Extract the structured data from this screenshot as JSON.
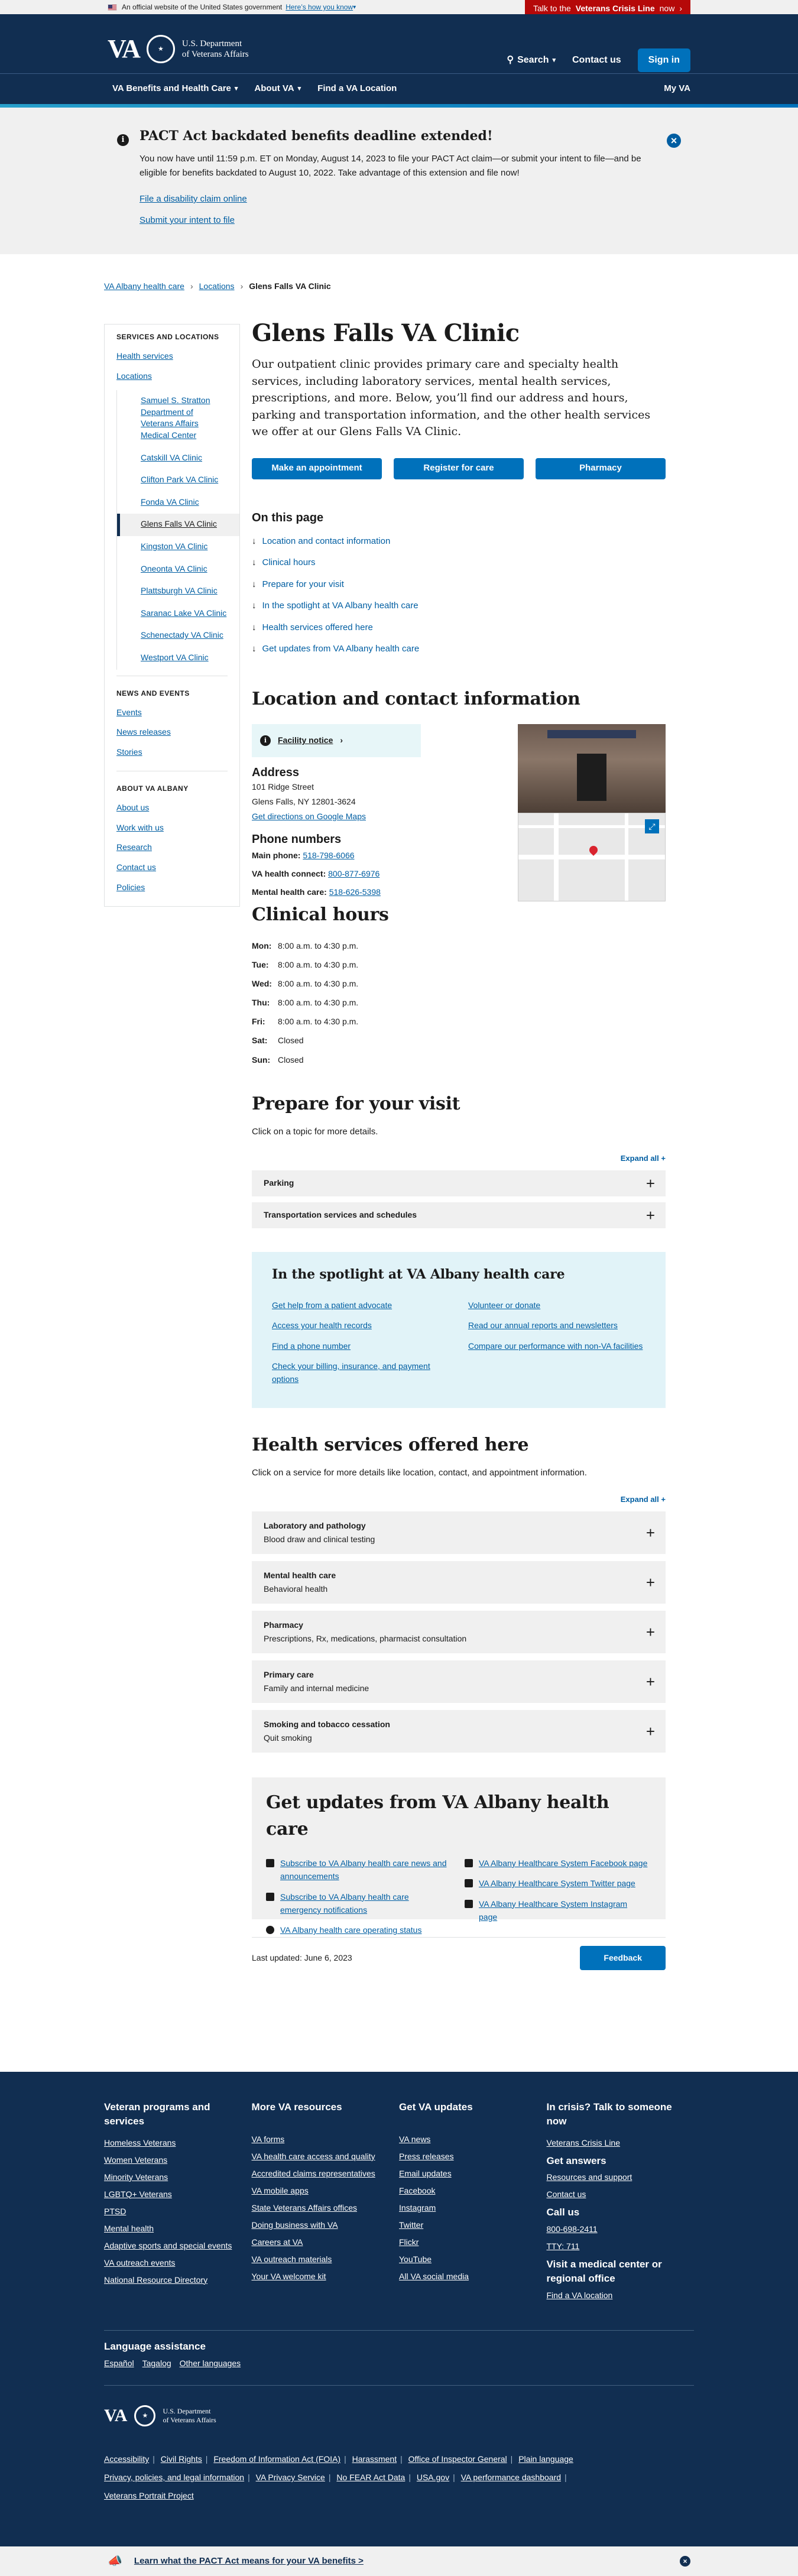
{
  "official_banner": {
    "text": "An official website of the United States government",
    "link": "Here’s how you know"
  },
  "crisis_button": {
    "prefix": "Talk to the",
    "bold": "Veterans Crisis Line",
    "suffix": "now"
  },
  "header": {
    "logo": "VA",
    "dept_line1": "U.S. Department",
    "dept_line2": "of Veterans Affairs",
    "search": "Search",
    "contact": "Contact us",
    "signin": "Sign in"
  },
  "nav": {
    "items": [
      "VA Benefits and Health Care",
      "About VA",
      "Find a VA Location"
    ],
    "myva": "My VA"
  },
  "alert": {
    "title": "PACT Act backdated benefits deadline extended!",
    "body": "You now have until 11:59 p.m. ET on Monday, August 14, 2023 to file your PACT Act claim—or submit your intent to file—and be eligible for benefits backdated to August 10, 2022. Take advantage of this extension and file now!",
    "link1": "File a disability claim online",
    "link2": "Submit your intent to file"
  },
  "breadcrumb": [
    "VA Albany health care",
    "Locations",
    "Glens Falls VA Clinic"
  ],
  "sidebar": {
    "heading": "SERVICES AND LOCATIONS",
    "health": "Health services",
    "locations": "Locations",
    "sublinks": [
      "Samuel S. Stratton Department of Veterans Affairs Medical Center",
      "Catskill VA Clinic",
      "Clifton Park VA Clinic",
      "Fonda VA Clinic",
      "Glens Falls VA Clinic",
      "Kingston VA Clinic",
      "Oneonta VA Clinic",
      "Plattsburgh VA Clinic",
      "Saranac Lake VA Clinic",
      "Schenectady VA Clinic",
      "Westport VA Clinic"
    ],
    "news_heading": "NEWS AND EVENTS",
    "news": [
      "Events",
      "News releases",
      "Stories"
    ],
    "about_heading": "ABOUT VA ALBANY",
    "about": [
      "About us",
      "Work with us",
      "Research",
      "Contact us",
      "Policies"
    ]
  },
  "main": {
    "title": "Glens Falls VA Clinic",
    "intro": "Our outpatient clinic provides primary care and specialty health services, including laboratory services, mental health services, prescriptions, and more. Below, you’ll find our address and hours, parking and transportation information, and the other health services we offer at our Glens Falls VA Clinic.",
    "buttons": [
      "Make an appointment",
      "Register for care",
      "Pharmacy"
    ],
    "on_this_page": "On this page",
    "toc": [
      "Location and contact information",
      "Clinical hours",
      "Prepare for your visit",
      "In the spotlight at VA Albany health care",
      "Health services offered here",
      "Get updates from VA Albany health care"
    ],
    "location_heading": "Location and contact information",
    "facility_notice": "Facility notice",
    "address_heading": "Address",
    "address1": "101 Ridge Street",
    "address2": "Glens Falls, NY 12801-3624",
    "directions": "Get directions on Google Maps",
    "phone_heading": "Phone numbers",
    "phones": [
      {
        "label": "Main phone:",
        "value": "518-798-6066"
      },
      {
        "label": "VA health connect:",
        "value": "800-877-6976"
      },
      {
        "label": "Mental health care:",
        "value": "518-626-5398"
      }
    ],
    "hours_heading": "Clinical hours",
    "hours": [
      {
        "day": "Mon:",
        "time": "8:00 a.m. to 4:30 p.m."
      },
      {
        "day": "Tue:",
        "time": "8:00 a.m. to 4:30 p.m."
      },
      {
        "day": "Wed:",
        "time": "8:00 a.m. to 4:30 p.m."
      },
      {
        "day": "Thu:",
        "time": "8:00 a.m. to 4:30 p.m."
      },
      {
        "day": "Fri:",
        "time": "8:00 a.m. to 4:30 p.m."
      },
      {
        "day": "Sat:",
        "time": "Closed"
      },
      {
        "day": "Sun:",
        "time": "Closed"
      }
    ],
    "prepare_heading": "Prepare for your visit",
    "prepare_sub": "Click on a topic for more details.",
    "expand_all": "Expand all +",
    "prepare_items": [
      "Parking",
      "Transportation services and schedules"
    ],
    "spotlight_heading": "In the spotlight at VA Albany health care",
    "spotlight_left": [
      "Get help from a patient advocate",
      "Access your health records",
      "Find a phone number",
      "Check your billing, insurance, and payment options"
    ],
    "spotlight_right": [
      "Volunteer or donate",
      "Read our annual reports and newsletters",
      "Compare our performance with non-VA facilities"
    ],
    "services_heading": "Health services offered here",
    "services_sub": "Click on a service for more details like location, contact, and appointment information.",
    "services": [
      {
        "name": "Laboratory and pathology",
        "desc": "Blood draw and clinical testing"
      },
      {
        "name": "Mental health care",
        "desc": "Behavioral health"
      },
      {
        "name": "Pharmacy",
        "desc": "Prescriptions, Rx, medications, pharmacist consultation"
      },
      {
        "name": "Primary care",
        "desc": "Family and internal medicine"
      },
      {
        "name": "Smoking and tobacco cessation",
        "desc": "Quit smoking"
      }
    ],
    "updates_heading": "Get updates from VA Albany health care",
    "updates_left": [
      "Subscribe to VA Albany health care news and announcements",
      "Subscribe to VA Albany health care emergency notifications",
      "VA Albany health care operating status"
    ],
    "updates_right": [
      "VA Albany Healthcare System Facebook page",
      "VA Albany Healthcare System Twitter page",
      "VA Albany Healthcare System Instagram page"
    ],
    "last_updated": "Last updated: June 6, 2023",
    "feedback": "Feedback"
  },
  "footer": {
    "col1_heading": "Veteran programs and services",
    "col1": [
      "Homeless Veterans",
      "Women Veterans",
      "Minority Veterans",
      "LGBTQ+ Veterans",
      "PTSD",
      "Mental health",
      "Adaptive sports and special events",
      "VA outreach events",
      "National Resource Directory"
    ],
    "col2_heading": "More VA resources",
    "col2": [
      "VA forms",
      "VA health care access and quality",
      "Accredited claims representatives",
      "VA mobile apps",
      "State Veterans Affairs offices",
      "Doing business with VA",
      "Careers at VA",
      "VA outreach materials",
      "Your VA welcome kit"
    ],
    "col3_heading": "Get VA updates",
    "col3": [
      "VA news",
      "Press releases",
      "Email updates",
      "Facebook",
      "Instagram",
      "Twitter",
      "Flickr",
      "YouTube",
      "All VA social media"
    ],
    "col4_heading1": "In crisis? Talk to someone now",
    "col4_link1": "Veterans Crisis Line",
    "col4_heading2": "Get answers",
    "col4_links2": [
      "Resources and support",
      "Contact us"
    ],
    "col4_heading3": "Call us",
    "col4_links3": [
      "800-698-2411",
      "TTY: 711"
    ],
    "col4_heading4": "Visit a medical center or regional office",
    "col4_link4": "Find a VA location",
    "lang_heading": "Language assistance",
    "langs": [
      "Español",
      "Tagalog",
      "Other languages"
    ],
    "logo": "VA",
    "dept_line1": "U.S. Department",
    "dept_line2": "of Veterans Affairs",
    "links": [
      "Accessibility",
      "Civil Rights",
      "Freedom of Information Act (FOIA)",
      "Harassment",
      "Office of Inspector General",
      "Plain language",
      "Privacy, policies, and legal information",
      "VA Privacy Service",
      "No FEAR Act Data",
      "USA.gov",
      "VA performance dashboard",
      "Veterans Portrait Project"
    ]
  },
  "pact_banner": {
    "text": "Learn what the PACT Act means for your VA benefits >"
  }
}
